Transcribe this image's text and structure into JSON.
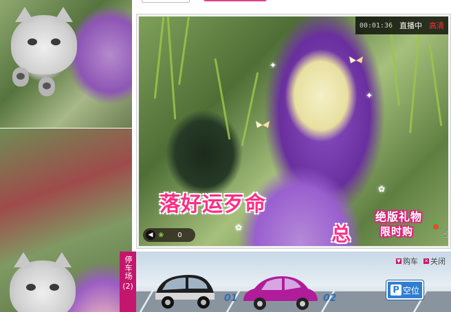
{
  "video": {
    "timer": "00:01:36",
    "status": "直播中",
    "quality": "高清",
    "overlay_text": "落好运歹命",
    "overlay_text_2": "总",
    "gift_badge_line1": "绝版礼物",
    "gift_badge_line2": "限时购",
    "flower_count": "0"
  },
  "parking": {
    "tab_label": "停车场",
    "tab_count": "(2)",
    "buy_label": "购车",
    "close_label": "关闭",
    "slot_1": "01",
    "slot_2": "02",
    "empty_label": "空位",
    "p_letter": "P"
  },
  "colors": {
    "accent_pink": "#e0237c",
    "parking_tab": "#c4166d",
    "sign_blue": "#2f7fd1"
  }
}
